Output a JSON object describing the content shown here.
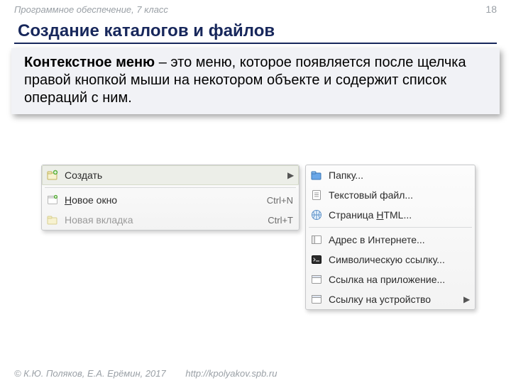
{
  "header": {
    "course": "Программное обеспечение, 7 класс",
    "page": "18"
  },
  "title": "Создание каталогов и файлов",
  "definition": {
    "term": "Контекстное меню",
    "text": " – это меню, которое появляется после щелчка правой кнопкой мыши на некотором объекте и содержит список операций с ним."
  },
  "menu1": {
    "items": [
      {
        "label": "Создать",
        "submenu": true
      },
      {
        "accel": "Н",
        "rest": "овое окно",
        "shortcut": "Ctrl+N"
      },
      {
        "label": "Новая вкладка",
        "shortcut": "Ctrl+T",
        "disabled": true
      }
    ]
  },
  "menu2": {
    "items": [
      {
        "label": "Папку..."
      },
      {
        "label": "Текстовый файл..."
      },
      {
        "before": "Страница ",
        "accel": "H",
        "after": "TML..."
      },
      {
        "label": "Адрес в Интернете..."
      },
      {
        "label": "Символическую ссылку..."
      },
      {
        "label": "Ссылка на приложение..."
      },
      {
        "label": "Ссылку на устройство",
        "submenu": true
      }
    ]
  },
  "footer": {
    "copyright": "© К.Ю. Поляков, Е.А. Ерёмин, 2017",
    "url": "http://kpolyakov.spb.ru"
  }
}
